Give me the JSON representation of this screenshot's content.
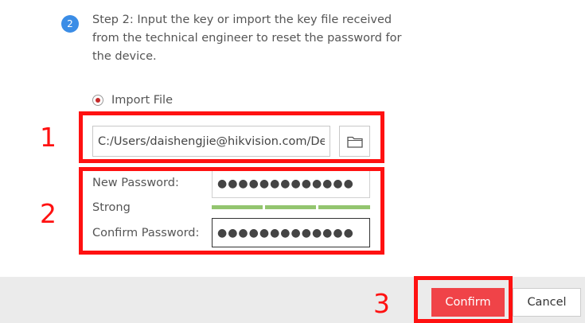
{
  "step": {
    "number": "2",
    "text": "Step 2: Input the key or import the key file received from the technical engineer to reset the password for the device."
  },
  "import_option": {
    "label": "Import File",
    "selected": true
  },
  "file_path": {
    "value": "C:/Users/daishengjie@hikvision.com/Desktop",
    "icon": "folder-icon"
  },
  "new_password": {
    "label": "New Password:",
    "value": "●●●●●●●●●●●●●"
  },
  "strength": {
    "label": "Strong",
    "level": 3,
    "max_level": 3,
    "color": "#93c56f"
  },
  "confirm_password": {
    "label": "Confirm Password:",
    "value": "●●●●●●●●●●●●●"
  },
  "footer": {
    "confirm_label": "Confirm",
    "cancel_label": "Cancel",
    "confirm_color": "#f04348"
  },
  "annotations": {
    "one": "1",
    "two": "2",
    "three": "3",
    "color": "#ff1111"
  }
}
